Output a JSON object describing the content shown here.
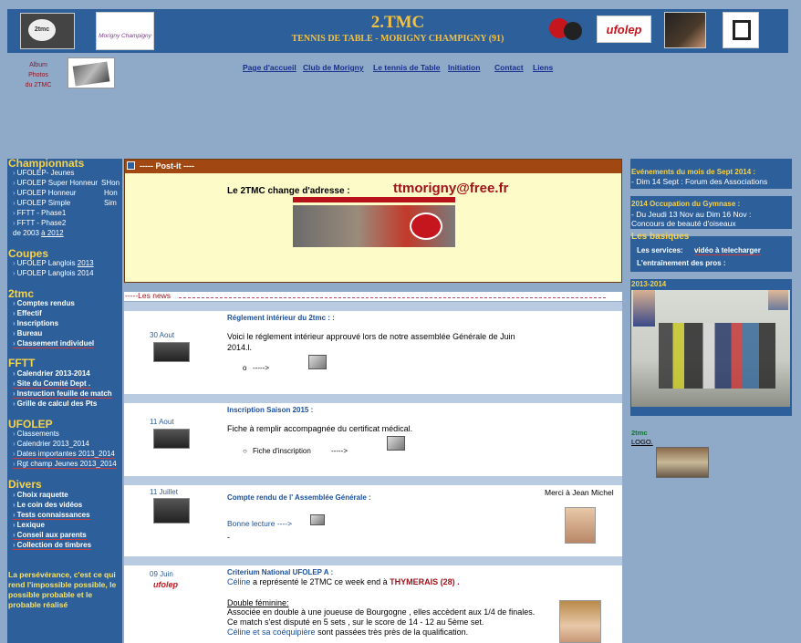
{
  "header": {
    "title": "2.TMC",
    "subtitle": "TENNIS DE TABLE - MORIGNY CHAMPIGNY (91)",
    "logo_left_text": "2tmc",
    "logo_morigny_text": "Morigny Champigny",
    "logo_ufolep_text": "ufolep"
  },
  "album": {
    "label_1": "Album",
    "label_2": "Photos",
    "label_3": "du 2TMC"
  },
  "nav": [
    "Page d'accueil",
    "Club de Morigny",
    "Le tennis de Table",
    "Initiation",
    "Contact",
    "Liens"
  ],
  "left": {
    "championnats": "Championnats",
    "c1": "UFOLEP- Jeunes",
    "c2": "UFOLEP Super Honneur",
    "c2r": "SHon",
    "c3": "UFOLEP Honneur",
    "c3r": "Hon",
    "c4": "UFOLEP Simple",
    "c4r": "Sim",
    "c5": "FFTT - Phase1",
    "c6": "FFTT - Phase2",
    "c7a": "de 2003",
    "c7b": "à 2012",
    "coupes": "Coupes",
    "k1a": "UFOLEP Langlois",
    "k1b": "2013",
    "k2": "UFOLEP Langlois 2014",
    "tmc": "2tmc",
    "t1": "Comptes rendus",
    "t2": "Effectif",
    "t3": "Inscriptions",
    "t4": "Bureau",
    "t5": "Classement  individuel",
    "fftt": "FFTT",
    "f1": "Calendrier  2013-2014",
    "f2": "Site du Comité Dept .",
    "f3": "Instruction feuille de match",
    "f4": "Grille de calcul des Pts",
    "ufolep": "UFOLEP",
    "u1": "Classements",
    "u2": "Calendrier 2013_2014",
    "u3": "Dates importantes 2013_2014",
    "u4": "Rgt champ Jeunes 2013_2014",
    "divers": "Divers",
    "d1": "Choix raquette",
    "d2": "Le coin des vidéos",
    "d3": "Tests connaissances",
    "d4": "Lexique",
    "d5": "Conseil aux parents",
    "d6": "Collection de timbres",
    "quote": "La persévérance, c'est ce qui rend l'impossible possible, le possible probable et le probable réalisé"
  },
  "postit": {
    "bar": "-----   Post-it   ----",
    "text": "Le 2TMC change d'adresse   :",
    "email": "ttmorigny@free.fr"
  },
  "news_label": "-----Les news",
  "news": [
    {
      "date": "30 Aout",
      "title": "Réglement  intérieur du 2tmc : :",
      "body": "Voici le réglement intérieur  approuvé lors de notre assemblée Générale de Juin 2014.l.",
      "link": "----->"
    },
    {
      "date": "11 Aout",
      "title": "Inscription  Saison 2015 :",
      "body": "Fiche à remplir accompagnée du  certificat médical.",
      "link_label": "Fiche d'inscription",
      "link": "----->"
    },
    {
      "date": "11 Juillet",
      "title": "Compte rendu de l' Assemblée Générale :",
      "thanks": "Merci à Jean Michel",
      "link": "Bonne lecture ---->",
      "dash": "-"
    },
    {
      "date": "09 Juin",
      "title": "Criterium National UFOLEP  A :",
      "line1_name": "Céline",
      "line1_rest": " a représenté le 2TMC ce week end à ",
      "line1_place": "THYMERAIS (28) .",
      "line2": "Double féminine:",
      "line3": "Associée en double  à une joueuse de Bourgogne , elles accèdent aux 1/4 de finales.",
      "line4": "Ce match  s'est disputé en 5 sets , sur le score de 14 - 12 au 5ème set.",
      "line5_blue": "Céline et sa coéquipière",
      "line5_rest": " sont passées très près de la qualification."
    }
  ],
  "right": {
    "ev_title": "Evénements du mois de Sept  2014 :",
    "ev_1": "- Dim 14 Sept  : Forum des Associations",
    "occ_title": "2014 Occupation du Gymnase :",
    "occ_1": "- Du Jeudi 13 Nov au Dim 16 Nov   :",
    "occ_2": "Concours de beauté d'oiseaux",
    "basiques": "Les basiques",
    "b1a": "Les services:",
    "b1b": "vidéo à telecharger",
    "b2": "L'entraînement des pros :",
    "season": "2013-2014",
    "tmc": "2tmc",
    "logo": "LOGO."
  }
}
